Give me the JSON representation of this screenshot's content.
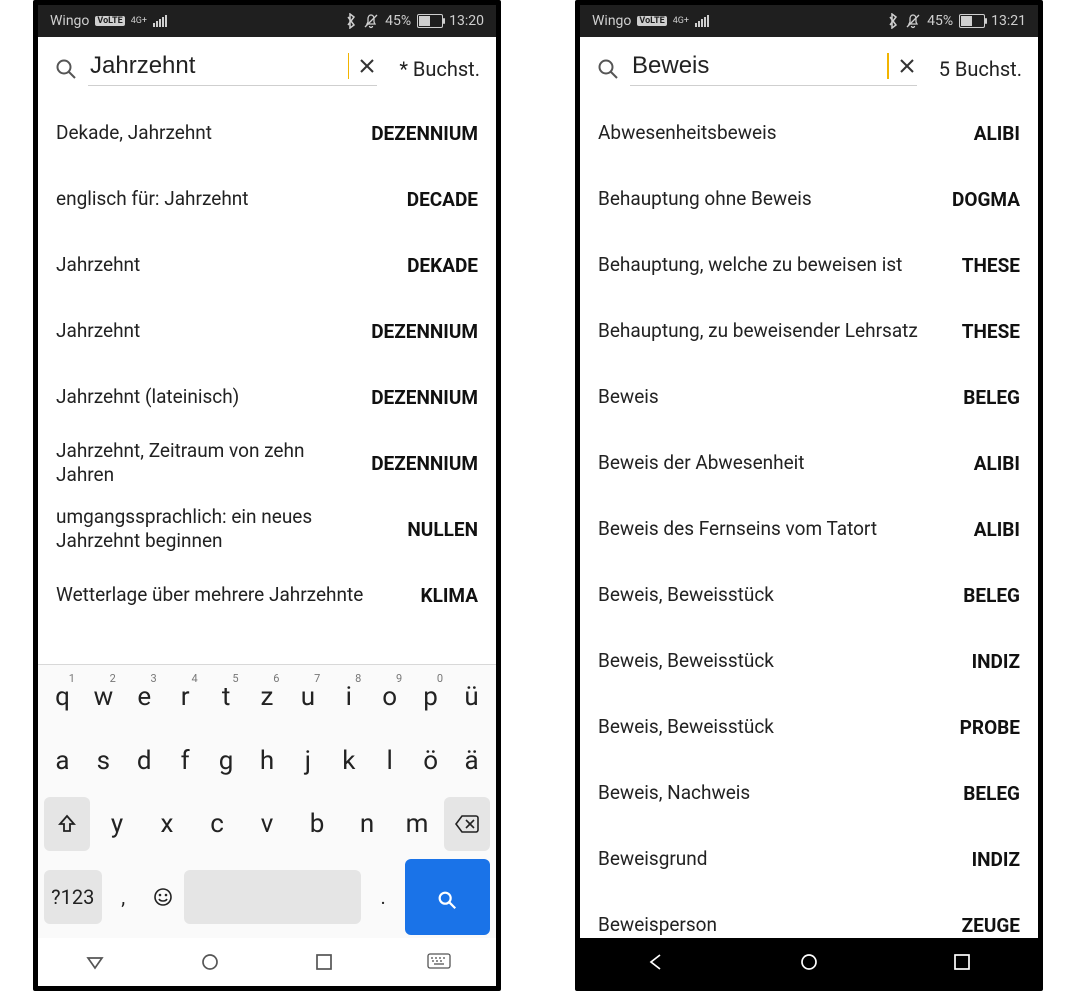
{
  "left": {
    "status": {
      "carrier": "Wingo",
      "bt": "✱",
      "battery_pct": "45%",
      "time": "13:20",
      "net": "4G+"
    },
    "search": {
      "value": "Jahrzehnt",
      "letters": "* Buchst."
    },
    "results": [
      {
        "clue": "Dekade, Jahrzehnt",
        "answer": "DEZENNIUM"
      },
      {
        "clue": "englisch für: Jahrzehnt",
        "answer": "DECADE"
      },
      {
        "clue": "Jahrzehnt",
        "answer": "DEKADE"
      },
      {
        "clue": "Jahrzehnt",
        "answer": "DEZENNIUM"
      },
      {
        "clue": "Jahrzehnt (lateinisch)",
        "answer": "DEZENNIUM"
      },
      {
        "clue": "Jahrzehnt, Zeitraum von zehn Jahren",
        "answer": "DEZENNIUM"
      },
      {
        "clue": "umgangssprachlich: ein neues Jahrzehnt beginnen",
        "answer": "NULLEN"
      },
      {
        "clue": "Wetterlage über mehrere Jahrzehnte",
        "answer": "KLIMA"
      }
    ],
    "keyboard": {
      "r1": [
        {
          "k": "q",
          "s": "1"
        },
        {
          "k": "w",
          "s": "2"
        },
        {
          "k": "e",
          "s": "3"
        },
        {
          "k": "r",
          "s": "4"
        },
        {
          "k": "t",
          "s": "5"
        },
        {
          "k": "z",
          "s": "6"
        },
        {
          "k": "u",
          "s": "7"
        },
        {
          "k": "i",
          "s": "8"
        },
        {
          "k": "o",
          "s": "9"
        },
        {
          "k": "p",
          "s": "0"
        },
        {
          "k": "ü",
          "s": ""
        }
      ],
      "r2": [
        {
          "k": "a"
        },
        {
          "k": "s"
        },
        {
          "k": "d"
        },
        {
          "k": "f"
        },
        {
          "k": "g"
        },
        {
          "k": "h"
        },
        {
          "k": "j"
        },
        {
          "k": "k"
        },
        {
          "k": "l"
        },
        {
          "k": "ö"
        },
        {
          "k": "ä"
        }
      ],
      "r3": [
        "y",
        "x",
        "c",
        "v",
        "b",
        "n",
        "m"
      ],
      "sym": "?123",
      "comma": ",",
      "period": "."
    }
  },
  "right": {
    "status": {
      "carrier": "Wingo",
      "bt": "✱",
      "battery_pct": "45%",
      "time": "13:21",
      "net": "4G+"
    },
    "search": {
      "value": "Beweis",
      "letters": "5 Buchst."
    },
    "results": [
      {
        "clue": "Abwesenheitsbeweis",
        "answer": "ALIBI"
      },
      {
        "clue": "Behauptung ohne Beweis",
        "answer": "DOGMA"
      },
      {
        "clue": "Behauptung, welche zu beweisen ist",
        "answer": "THESE"
      },
      {
        "clue": "Behauptung, zu beweisender Lehrsatz",
        "answer": "THESE"
      },
      {
        "clue": "Beweis",
        "answer": "BELEG"
      },
      {
        "clue": "Beweis der Abwesenheit",
        "answer": "ALIBI"
      },
      {
        "clue": "Beweis des Fernseins vom Tatort",
        "answer": "ALIBI"
      },
      {
        "clue": "Beweis, Beweisstück",
        "answer": "BELEG"
      },
      {
        "clue": "Beweis, Beweisstück",
        "answer": "INDIZ"
      },
      {
        "clue": "Beweis, Beweisstück",
        "answer": "PROBE"
      },
      {
        "clue": "Beweis, Nachweis",
        "answer": "BELEG"
      },
      {
        "clue": "Beweisgrund",
        "answer": "INDIZ"
      },
      {
        "clue": "Beweisperson",
        "answer": "ZEUGE"
      }
    ]
  }
}
